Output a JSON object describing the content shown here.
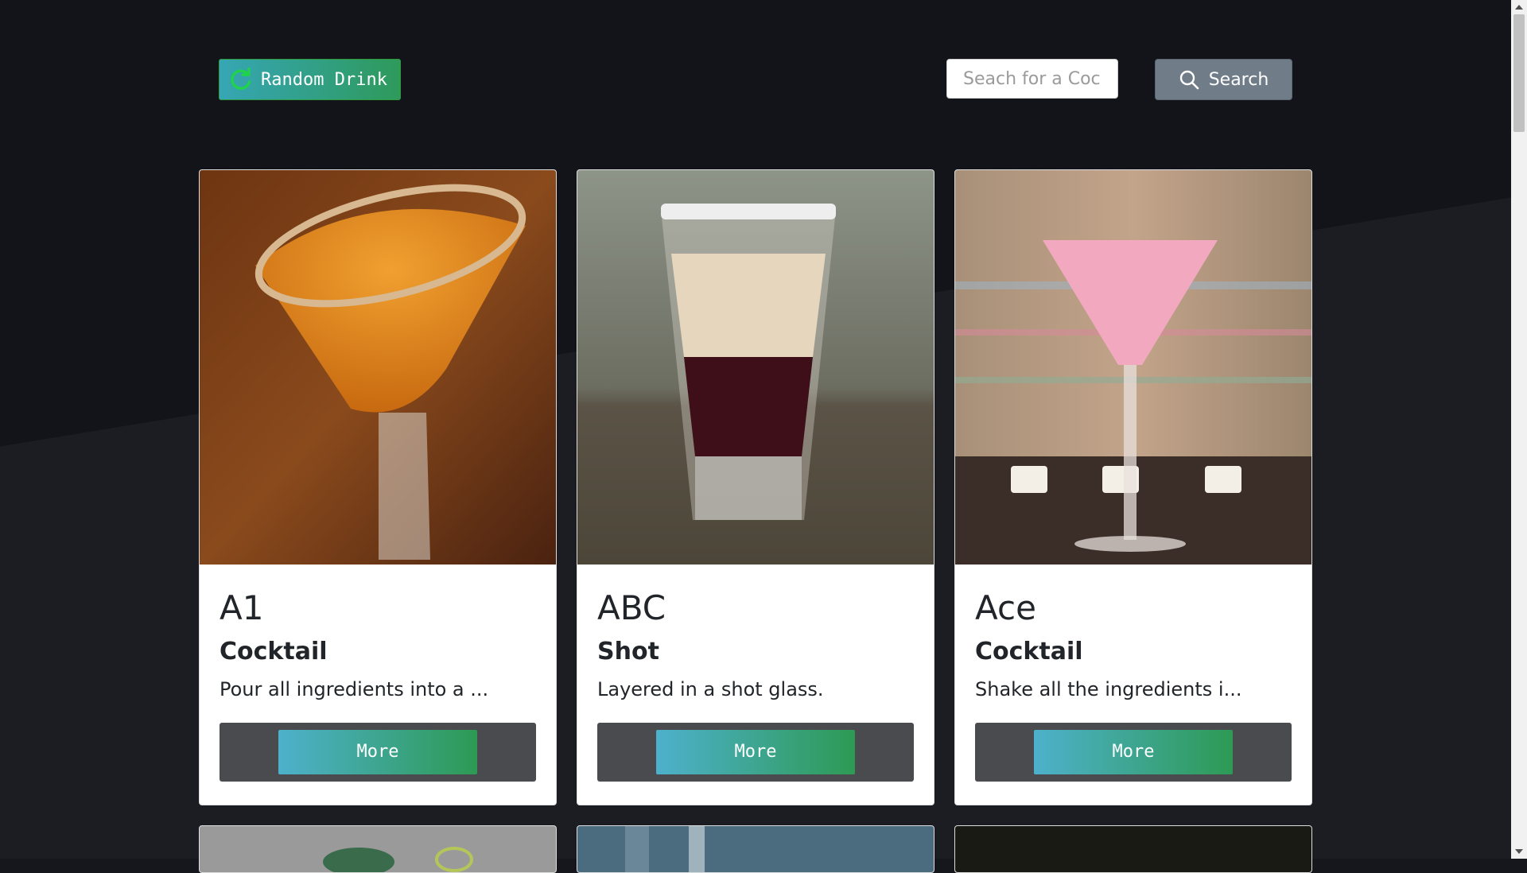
{
  "header": {
    "random_label": "Random Drink",
    "search_placeholder": "Seach for a Cocktail",
    "search_label": "Search"
  },
  "drinks": [
    {
      "name": "A1",
      "category": "Cocktail",
      "description": "Pour all ingredients into a ...",
      "more_label": "More"
    },
    {
      "name": "ABC",
      "category": "Shot",
      "description": "Layered in a shot glass.",
      "more_label": "More"
    },
    {
      "name": "Ace",
      "category": "Cocktail",
      "description": "Shake all the ingredients i...",
      "more_label": "More"
    }
  ],
  "colors": {
    "accent_teal": "#36a6b5",
    "accent_green": "#2e9a5b",
    "background": "#16171c"
  },
  "icons": {
    "random": "refresh-icon",
    "search": "magnifier-icon"
  }
}
